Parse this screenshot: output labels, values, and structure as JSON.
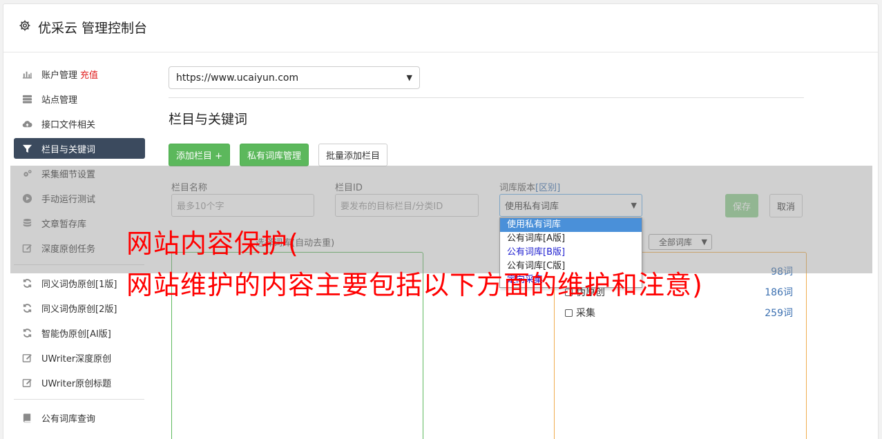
{
  "header": {
    "title": "优采云 管理控制台",
    "icon": "gear-icon"
  },
  "sidebar": {
    "group1": [
      {
        "label": "账户管理",
        "extra": "充值",
        "icon": "bar-chart-icon"
      },
      {
        "label": "站点管理",
        "icon": "server-icon"
      },
      {
        "label": "接口文件相关",
        "icon": "cloud-upload-icon"
      },
      {
        "label": "栏目与关键词",
        "icon": "filter-icon",
        "active": true
      },
      {
        "label": "采集细节设置",
        "icon": "cogs-icon"
      },
      {
        "label": "手动运行测试",
        "icon": "play-icon"
      },
      {
        "label": "文章暂存库",
        "icon": "database-icon"
      },
      {
        "label": "深度原创任务",
        "icon": "edit-icon"
      }
    ],
    "group2": [
      {
        "label": "同义词伪原创[1版]",
        "icon": "refresh-icon"
      },
      {
        "label": "同义词伪原创[2版]",
        "icon": "refresh-icon"
      },
      {
        "label": "智能伪原创[AI版]",
        "icon": "refresh-icon"
      },
      {
        "label": "UWriter深度原创",
        "icon": "edit-icon"
      },
      {
        "label": "UWriter原创标题",
        "icon": "edit-icon"
      }
    ],
    "group3": [
      {
        "label": "公有词库查询",
        "icon": "book-icon"
      }
    ]
  },
  "main": {
    "site_select": "https://www.ucaiyun.com",
    "section_title": "栏目与关键词",
    "buttons": {
      "add_column": "添加栏目 +",
      "private_lib": "私有词库管理",
      "batch_add": "批量添加栏目"
    }
  },
  "form": {
    "column_name_label": "栏目名称",
    "column_name_placeholder": "最多10个字",
    "column_id_label": "栏目ID",
    "column_id_placeholder": "要发布的目标栏目/分类ID",
    "lib_version_label": "词库版本",
    "lib_version_link": "[区别]",
    "lib_version_value": "使用私有词库",
    "save": "保存",
    "cancel": "取消"
  },
  "dropdown": {
    "options": [
      "使用私有词库",
      "公有词库[A版]",
      "公有词库[B版]",
      "公有词库[C版]",
      "定向采集"
    ]
  },
  "libs": {
    "left_label": "选择词库(自动去重)",
    "filter_value": "全部词库",
    "rows": [
      {
        "name": "",
        "count": "98词"
      },
      {
        "name": "伪原创",
        "count": "186词"
      },
      {
        "name": "采集",
        "count": "259词"
      }
    ]
  },
  "banner": {
    "line1": "网站内容保护(",
    "line2": "网站维护的内容主要包括以下方面的维护和注意)"
  },
  "colors": {
    "active_nav": "#3b4a5e",
    "green": "#5cb85c",
    "banner_red": "#ff0000",
    "recharge_red": "#e02020"
  }
}
